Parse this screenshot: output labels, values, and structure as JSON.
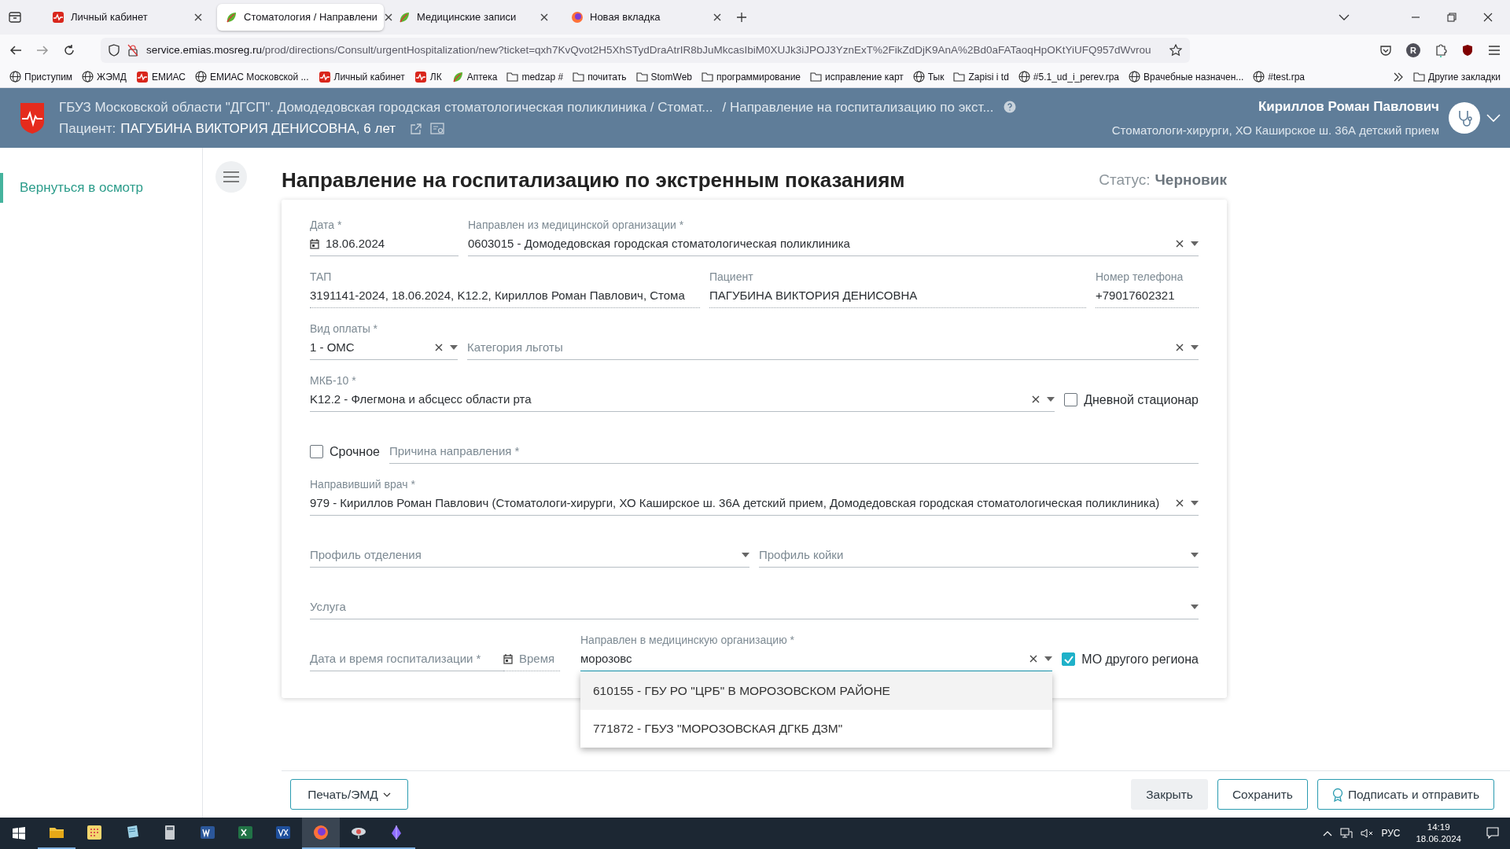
{
  "browser": {
    "tabs": [
      {
        "title": "Личный кабинет",
        "kind": "pulse",
        "selected": false
      },
      {
        "title": "Стоматология / Направлени",
        "kind": "leaf",
        "selected": true
      },
      {
        "title": "Медицинские записи",
        "kind": "leaf",
        "selected": false
      },
      {
        "title": "Новая вкладка",
        "kind": "fox",
        "selected": false
      }
    ],
    "url_host": "service.emias.mosreg.ru",
    "url_path": "/prod/directions/Consult/urgentHospitalization/new?ticket=qxh7KvQvot2H5XhSTydDraAtrIR8bJuMkcasIbiM0XUJk3iJPOJ3YznExT%2FikZdDjK9AnA%2Bd0aFATaoqHpOKtYiUFQ957dWvrou",
    "profile_initial": "R",
    "bookmarks": [
      {
        "label": "Приступим",
        "kind": "globe"
      },
      {
        "label": "ЖЭМД",
        "kind": "globe"
      },
      {
        "label": "ЕМИАС",
        "kind": "pulse"
      },
      {
        "label": "ЕМИАС Московской ...",
        "kind": "globe"
      },
      {
        "label": "Личный кабинет",
        "kind": "pulse"
      },
      {
        "label": "ЛК",
        "kind": "pulse"
      },
      {
        "label": "Аптека",
        "kind": "leaf"
      },
      {
        "label": "medzap #",
        "kind": "folder"
      },
      {
        "label": "почитать",
        "kind": "folder"
      },
      {
        "label": "StomWeb",
        "kind": "folder"
      },
      {
        "label": "программирование",
        "kind": "folder"
      },
      {
        "label": "исправление карт",
        "kind": "folder"
      },
      {
        "label": "Тык",
        "kind": "globe"
      },
      {
        "label": "Zapisi i td",
        "kind": "folder"
      },
      {
        "label": "#5.1_ud_i_perev.rpa",
        "kind": "globe"
      },
      {
        "label": "Врачебные назначен...",
        "kind": "globe"
      },
      {
        "label": "#test.rpa",
        "kind": "globe"
      }
    ],
    "other_bookmarks": "Другие закладки"
  },
  "header": {
    "org": "ГБУЗ Московской области \"ДГСП\". Домодедовская городская стоматологическая поликлиника / Стомат...",
    "page": "/ Направление на госпитализацию по экст...",
    "patient_label": "Пациент:",
    "patient_value": "ПАГУБИНА ВИКТОРИЯ ДЕНИСОВНА, 6 лет",
    "user_name": "Кириллов Роман Павлович",
    "user_role": "Стоматологи-хирурги, ХО Каширское ш. 36А детский прием"
  },
  "sidebar": {
    "items": [
      {
        "label": "Вернуться в осмотр",
        "selected": true
      }
    ]
  },
  "page": {
    "title": "Направление на госпитализацию по экстренным показаниям",
    "status_label": "Статус:",
    "status_value": "Черновик"
  },
  "form": {
    "date": {
      "label": "Дата *",
      "value": "18.06.2024"
    },
    "from_org": {
      "label": "Направлен из медицинской организации *",
      "value": "0603015 - Домодедовская городская стоматологическая поликлиника",
      "clearable": true
    },
    "tap": {
      "label": "ТАП",
      "value": "3191141-2024, 18.06.2024, K12.2, Кириллов Роман Павлович, Стома"
    },
    "patient": {
      "label": "Пациент",
      "value": "ПАГУБИНА ВИКТОРИЯ ДЕНИСОВНА"
    },
    "phone": {
      "label": "Номер телефона",
      "value": "+79017602321"
    },
    "payment": {
      "label": "Вид оплаты *",
      "value": "1 - ОМС",
      "clearable": true
    },
    "benefit": {
      "placeholder": "Категория льготы",
      "clearable": true
    },
    "mkb": {
      "label": "МКБ-10 *",
      "value": "K12.2 - Флегмона и абсцесс области рта",
      "clearable": true
    },
    "day_hospital": {
      "label": "Дневной стационар",
      "checked": false
    },
    "urgent": {
      "label": "Срочное",
      "checked": false
    },
    "reason": {
      "placeholder": "Причина направления *"
    },
    "doctor": {
      "label": "Направивший врач *",
      "value": "979 - Кириллов Роман Павлович (Стоматологи-хирурги, ХО Каширское ш. 36А детский прием, Домодедовская городская стоматологическая поликлиника)",
      "clearable": true
    },
    "dept_profile": {
      "placeholder": "Профиль отделения"
    },
    "bed_profile": {
      "placeholder": "Профиль койки"
    },
    "service": {
      "placeholder": "Услуга"
    },
    "hosp_date": {
      "placeholder": "Дата и время госпитализации *"
    },
    "hosp_time": {
      "placeholder": "Время"
    },
    "to_org": {
      "label": "Направлен в медицинскую организацию *",
      "value": "морозовс",
      "clearable": true,
      "focused": true,
      "options": [
        {
          "label": "610155 - ГБУ РО \"ЦРБ\" В МОРОЗОВСКОМ РАЙОНЕ",
          "selected": true
        },
        {
          "label": "771872 - ГБУЗ \"МОРОЗОВСКАЯ ДГКБ ДЗМ\"",
          "selected": false
        }
      ]
    },
    "other_region": {
      "label": "МО другого региона",
      "checked": true
    }
  },
  "footer": {
    "print": "Печать/ЭМД",
    "close": "Закрыть",
    "save": "Сохранить",
    "sign": "Подписать и отправить"
  },
  "taskbar": {
    "language": "РУС",
    "time": "14:19",
    "date": "18.06.2024"
  }
}
